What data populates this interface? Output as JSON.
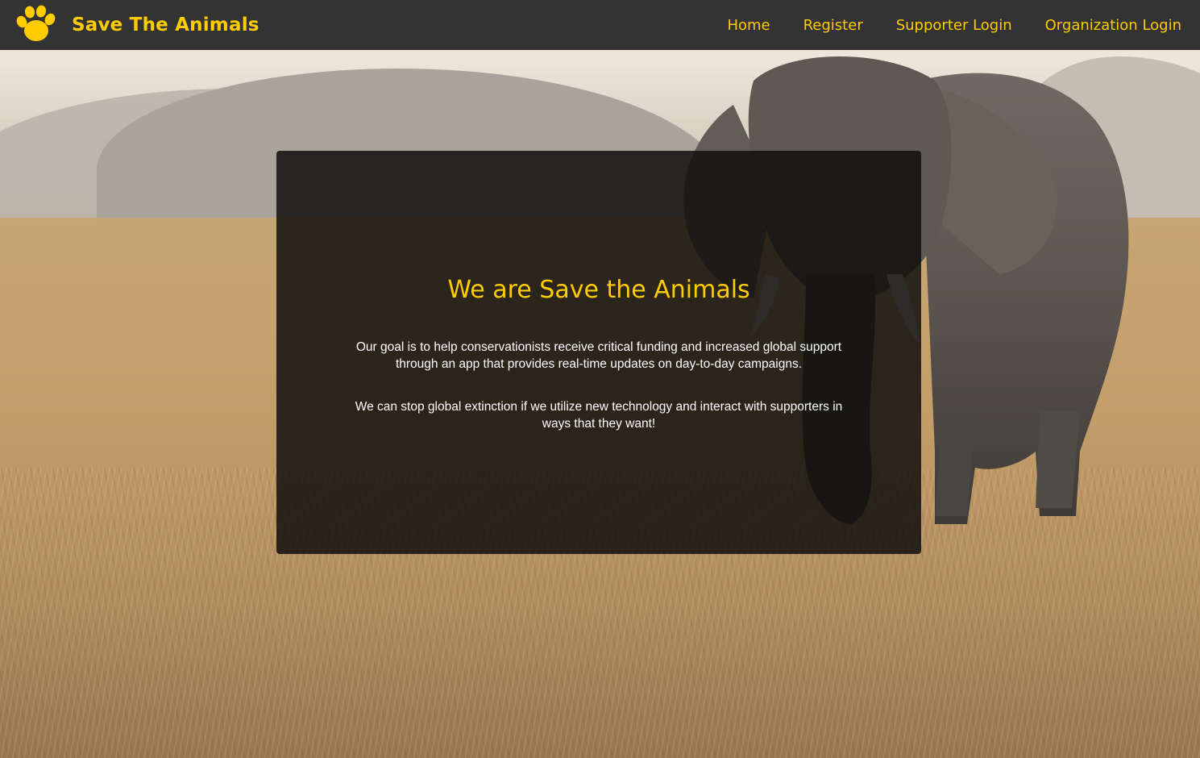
{
  "brand": {
    "logo_icon": "paw-icon",
    "name": "Save The Animals"
  },
  "nav": {
    "items": [
      {
        "label": "Home"
      },
      {
        "label": "Register"
      },
      {
        "label": "Supporter Login"
      },
      {
        "label": "Organization Login"
      }
    ]
  },
  "hero": {
    "title": "We are Save the Animals",
    "paragraphs": [
      "Our goal is to help conservationists receive critical funding and increased global support through an app that provides real-time updates on day-to-day campaigns.",
      "We can stop global extinction if we utilize new technology and interact with supporters in ways that they want!"
    ]
  },
  "colors": {
    "accent": "#ffcc00",
    "navbar_bg": "#333333",
    "card_bg": "rgba(18,16,14,0.86)",
    "text_light": "#ffffff"
  }
}
